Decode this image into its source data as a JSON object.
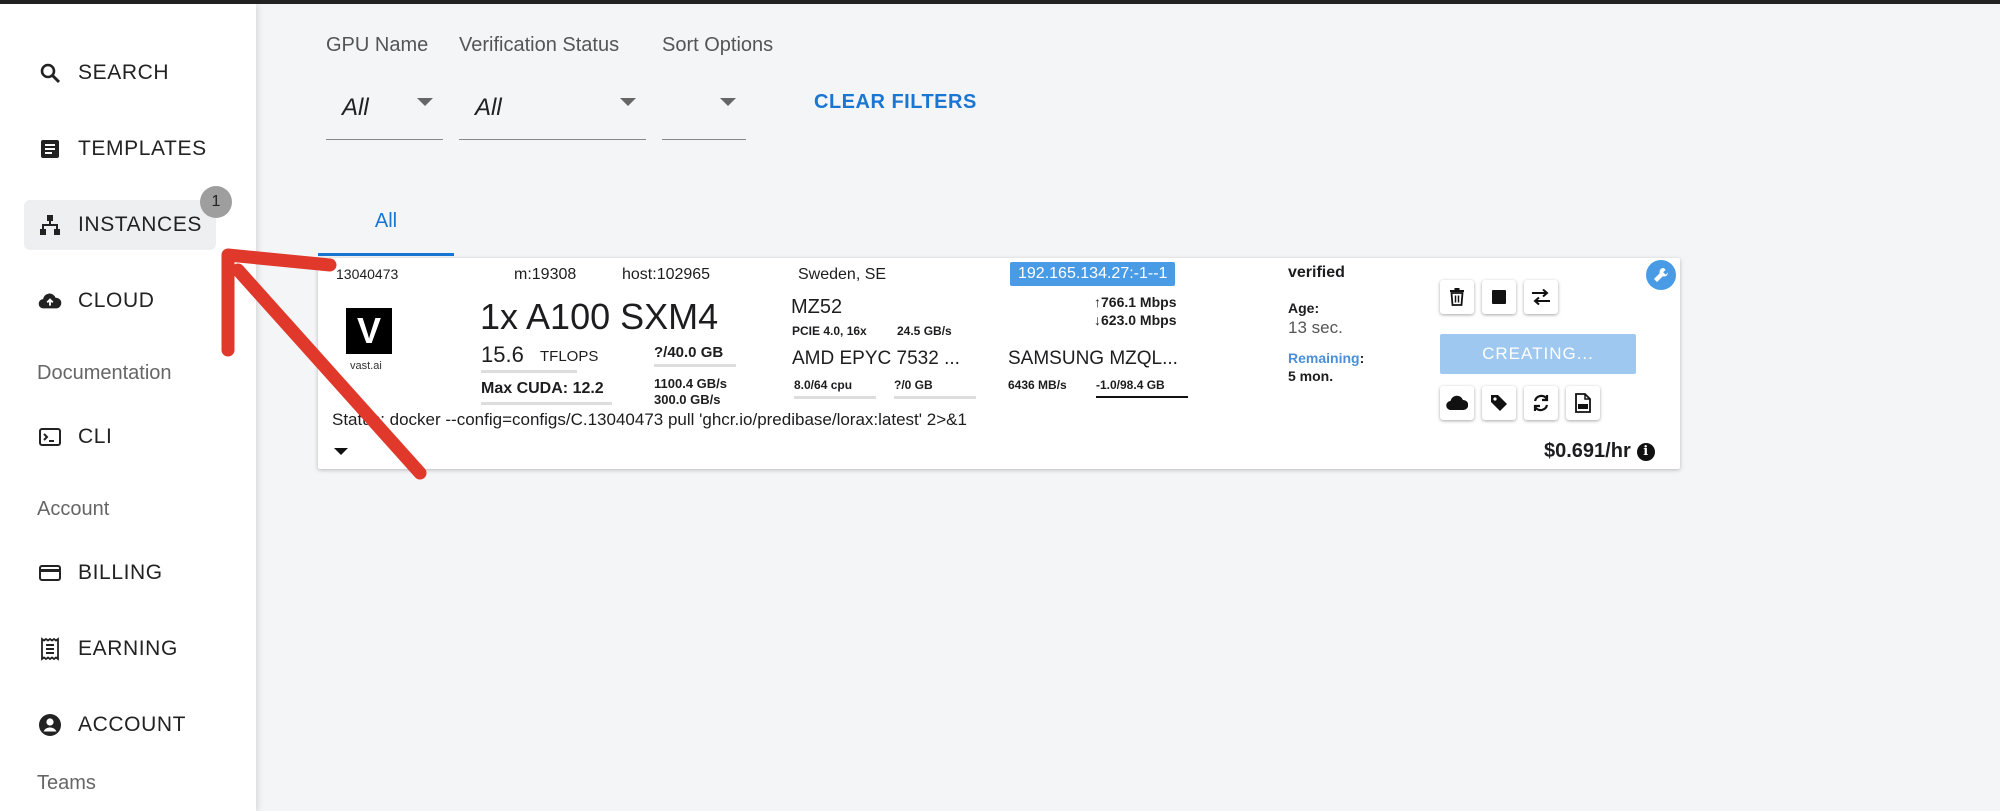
{
  "sidebar": {
    "items": [
      {
        "label": "SEARCH",
        "icon": "search-icon"
      },
      {
        "label": "TEMPLATES",
        "icon": "document-icon"
      },
      {
        "label": "INSTANCES",
        "icon": "hierarchy-icon",
        "badge": "1"
      },
      {
        "label": "CLOUD",
        "icon": "cloud-upload-icon"
      },
      {
        "label": "CLI",
        "icon": "terminal-icon"
      },
      {
        "label": "BILLING",
        "icon": "credit-card-icon"
      },
      {
        "label": "EARNING",
        "icon": "receipt-icon"
      },
      {
        "label": "ACCOUNT",
        "icon": "account-circle-icon"
      }
    ],
    "sections": {
      "documentation": "Documentation",
      "account": "Account",
      "teams": "Teams"
    }
  },
  "filters": {
    "gpu_name": {
      "label": "GPU Name",
      "value": "All"
    },
    "verification_status": {
      "label": "Verification Status",
      "value": "All"
    },
    "sort_options": {
      "label": "Sort Options",
      "value": ""
    },
    "clear_label": "CLEAR FILTERS"
  },
  "tabs": [
    {
      "label": "All"
    }
  ],
  "instance": {
    "id": "13040473",
    "machine": "m:19308",
    "host": "host:102965",
    "location": "Sweden, SE",
    "ip": "192.165.134.27:-1--1",
    "verified": "verified",
    "logo_letter": "V",
    "logo_text": "vast.ai",
    "gpu": "1x A100 SXM4",
    "tflops_value": "15.6",
    "tflops_unit": "TFLOPS",
    "max_cuda": "Max CUDA: 12.2",
    "vram": "?/40.0 GB",
    "bw1": "1100.4 GB/s",
    "bw2": "300.0 GB/s",
    "motherboard": "MZ52",
    "pcie": "PCIE 4.0, 16x",
    "pcie_bw": "24.5 GB/s",
    "cpu": "AMD EPYC 7532 ...",
    "cpu_cores": "8.0/64 cpu",
    "ram": "?/0 GB",
    "upload": "766.1 Mbps",
    "download": "623.0 Mbps",
    "disk": "SAMSUNG MZQL...",
    "disk_speed": "6436 MB/s",
    "disk_usage": "-1.0/98.4 GB",
    "age_label": "Age:",
    "age_value": "13 sec.",
    "remaining_label": "Remaining",
    "remaining_colon": ":",
    "remaining_value": "5 mon.",
    "status_text": "Status: docker --config=configs/C.13040473 pull 'ghcr.io/predibase/lorax:latest' 2>&1",
    "creating_label": "CREATING...",
    "price": "$0.691/hr"
  },
  "colors": {
    "accent": "#1976d2",
    "ip_badge": "#4a9be6",
    "creating": "#9ec8f0",
    "annotation_arrow": "#e0392b"
  }
}
